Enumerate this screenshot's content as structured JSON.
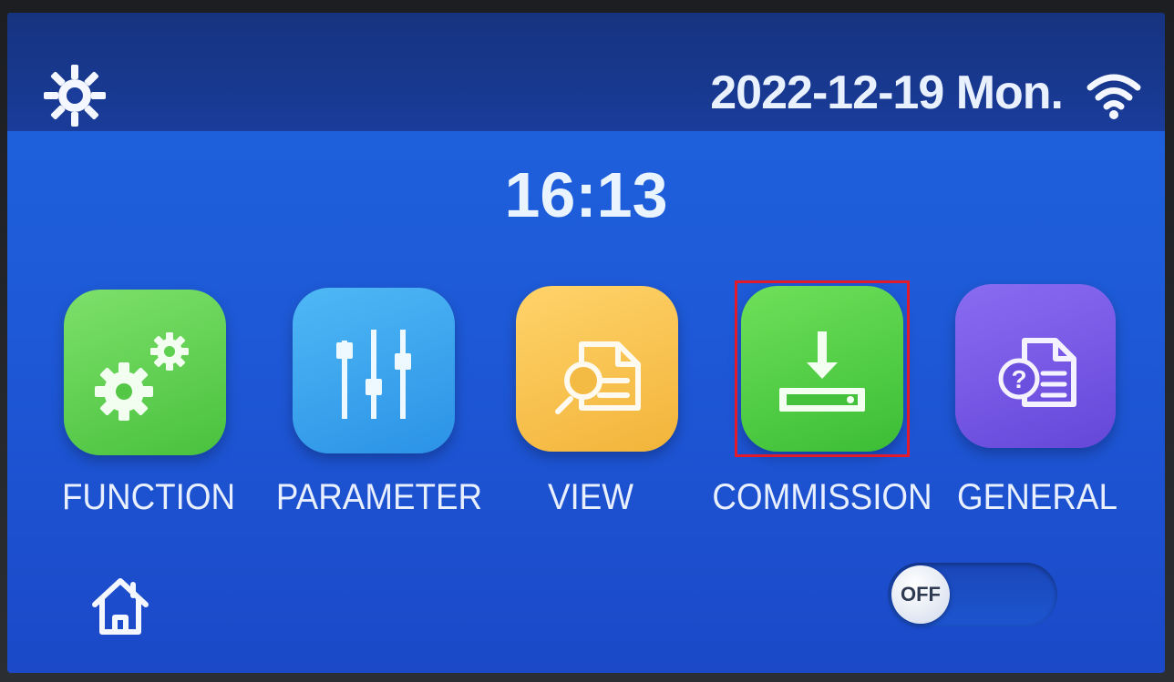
{
  "status": {
    "date": "2022-12-19 Mon.",
    "icons": {
      "left": "sun-gear-icon",
      "right": "wifi-icon"
    }
  },
  "clock": {
    "time": "16:13"
  },
  "menu": {
    "items": [
      {
        "label": "FUNCTION",
        "icon": "gears-icon",
        "color": "#5bcf4b"
      },
      {
        "label": "PARAMETER",
        "icon": "sliders-icon",
        "color": "#3aa6ef"
      },
      {
        "label": "VIEW",
        "icon": "document-search-icon",
        "color": "#f7c24f"
      },
      {
        "label": "COMMISSION",
        "icon": "download-tray-icon",
        "color": "#4ccb40",
        "selected": true
      },
      {
        "label": "GENERAL",
        "icon": "help-document-icon",
        "color": "#7558e6"
      }
    ],
    "selection_color": "#e21a2a"
  },
  "footer": {
    "home_icon": "home-icon",
    "power_toggle": {
      "state": "OFF"
    }
  },
  "colors": {
    "screen_background": "#1e5ad8",
    "status_bar": "#16337f",
    "text": "#e9f1ff"
  }
}
